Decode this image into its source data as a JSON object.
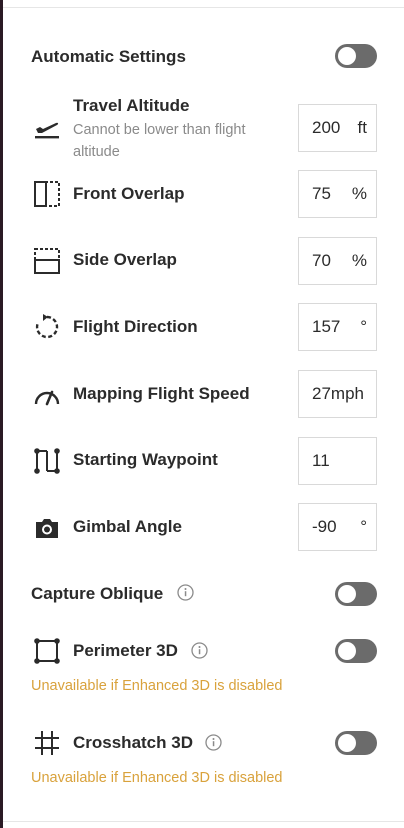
{
  "automatic": {
    "label": "Automatic Settings",
    "enabled": false
  },
  "travel_altitude": {
    "label": "Travel Altitude",
    "hint": "Cannot be lower than flight altitude",
    "value": "200",
    "unit": "ft",
    "icon": "takeoff-icon"
  },
  "front_overlap": {
    "label": "Front Overlap",
    "value": "75",
    "unit": "%",
    "icon": "front-overlap-icon"
  },
  "side_overlap": {
    "label": "Side Overlap",
    "value": "70",
    "unit": "%",
    "icon": "side-overlap-icon"
  },
  "flight_direction": {
    "label": "Flight Direction",
    "value": "157",
    "unit": "°",
    "icon": "rotate-icon"
  },
  "speed": {
    "label": "Mapping Flight Speed",
    "value": "27mph",
    "icon": "speedometer-icon"
  },
  "starting_waypoint": {
    "label": "Starting Waypoint",
    "value": "11",
    "icon": "waypoint-path-icon"
  },
  "gimbal": {
    "label": "Gimbal Angle",
    "value": "-90",
    "unit": "°",
    "icon": "camera-icon"
  },
  "capture_oblique": {
    "label": "Capture Oblique",
    "enabled": false
  },
  "perimeter3d": {
    "label": "Perimeter 3D",
    "enabled": false,
    "warning": "Unavailable if Enhanced 3D is disabled",
    "icon": "perimeter-icon"
  },
  "crosshatch3d": {
    "label": "Crosshatch 3D",
    "enabled": false,
    "warning": "Unavailable if Enhanced 3D is disabled",
    "icon": "crosshatch-icon"
  },
  "colors": {
    "toggle_off": "#6b6b6b",
    "warning": "#d9a23c",
    "text": "#2b2b2b",
    "hint": "#8a8a8a"
  }
}
